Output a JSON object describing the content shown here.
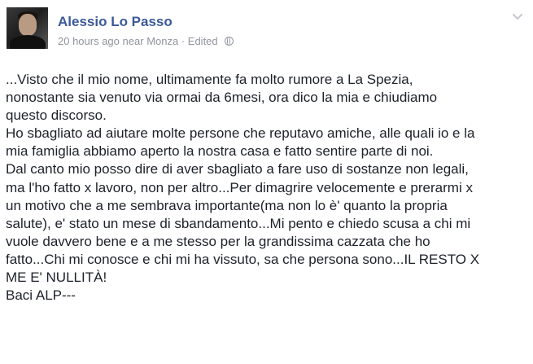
{
  "post": {
    "author": "Alessio Lo Passo",
    "time": "20 hours ago",
    "near": "near",
    "location": "Monza",
    "separator": " · ",
    "edited": "Edited",
    "lines": [
      "...Visto che il mio nome, ultimamente fa molto rumore a La Spezia,",
      "nonostante sia venuto via ormai da 6mesi, ora dico la mia e chiudiamo",
      "questo discorso.",
      "Ho sbagliato ad aiutare molte persone che reputavo amiche, alle quali io e la",
      "mia famiglia abbiamo aperto la nostra casa e fatto sentire parte di noi.",
      "Dal canto mio posso dire di aver sbagliato a fare uso di sostanze non legali,",
      "ma l'ho fatto x lavoro, non per altro...Per dimagrire velocemente e prerarmi x",
      "un motivo che a me sembrava importante(ma non lo è' quanto la propria",
      "salute), e' stato un mese di sbandamento...Mi pento e chiedo scusa a chi mi",
      "vuole davvero bene e a me stesso per la grandissima cazzata che ho",
      "fatto...Chi mi conosce e chi mi ha vissuto, sa che persona sono...IL RESTO X",
      "ME E' NULLITÀ!",
      "Baci ALP---"
    ]
  },
  "icons": {
    "avatar": "profile-photo",
    "privacy": "globe-icon",
    "menu": "chevron-down-icon"
  }
}
